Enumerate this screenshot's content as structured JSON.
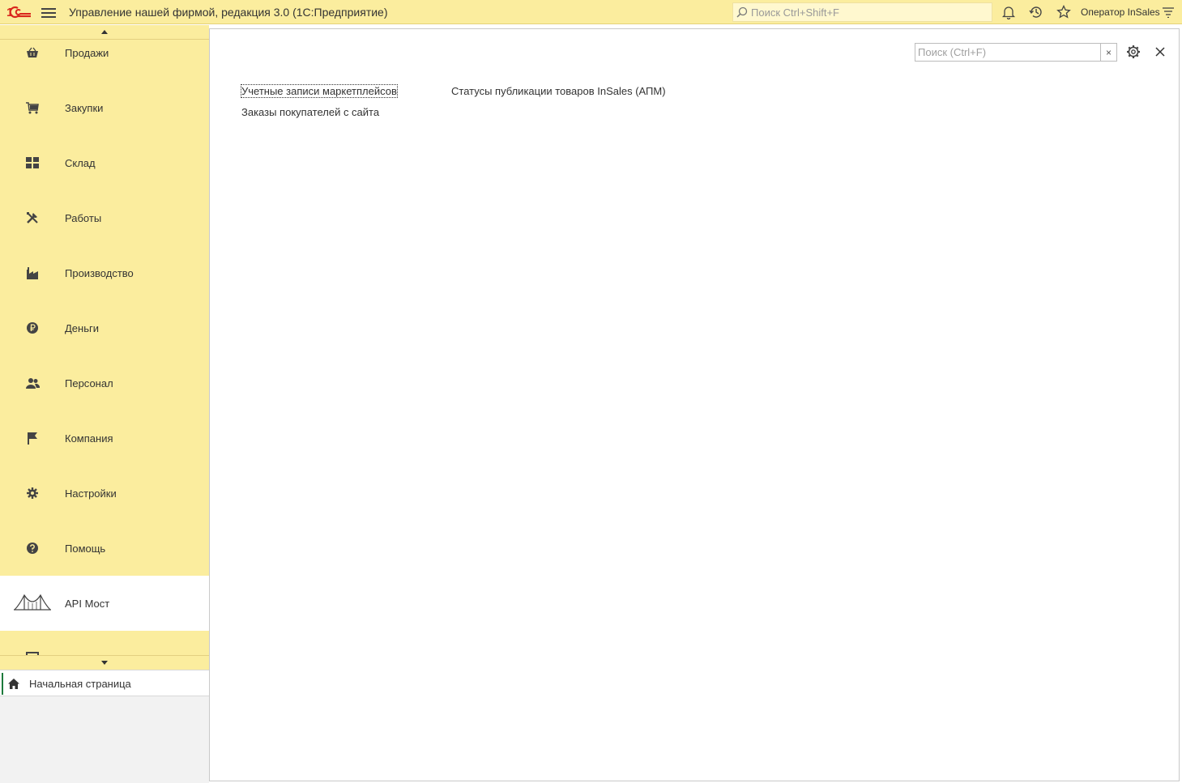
{
  "titlebar": {
    "app_title": "Управление нашей фирмой, редакция 3.0  (1С:Предприятие)",
    "search_placeholder": "Поиск Ctrl+Shift+F",
    "user_name": "Оператор InSales"
  },
  "sidebar": {
    "items": [
      {
        "label": "Продажи",
        "icon": "basket-icon"
      },
      {
        "label": "Закупки",
        "icon": "cart-icon"
      },
      {
        "label": "Склад",
        "icon": "warehouse-icon"
      },
      {
        "label": "Работы",
        "icon": "tools-icon"
      },
      {
        "label": "Производство",
        "icon": "factory-icon"
      },
      {
        "label": "Деньги",
        "icon": "ruble-icon"
      },
      {
        "label": "Персонал",
        "icon": "people-icon"
      },
      {
        "label": "Компания",
        "icon": "flag-icon"
      },
      {
        "label": "Настройки",
        "icon": "gear-icon"
      },
      {
        "label": "Помощь",
        "icon": "help-icon"
      },
      {
        "label": "API Мост",
        "icon": "bridge-icon",
        "active": true
      }
    ],
    "home_tab_label": "Начальная страница"
  },
  "main": {
    "search_placeholder": "Поиск (Ctrl+F)",
    "clear_label": "×",
    "links": [
      "Учетные записи маркетплейсов",
      "Заказы покупателей с сайта",
      "Статусы публикации товаров InSales (АПМ)"
    ]
  },
  "colors": {
    "accent_yellow": "#fbed9e",
    "home_marker": "#1d7a3c",
    "logo_red": "#d9261c"
  }
}
